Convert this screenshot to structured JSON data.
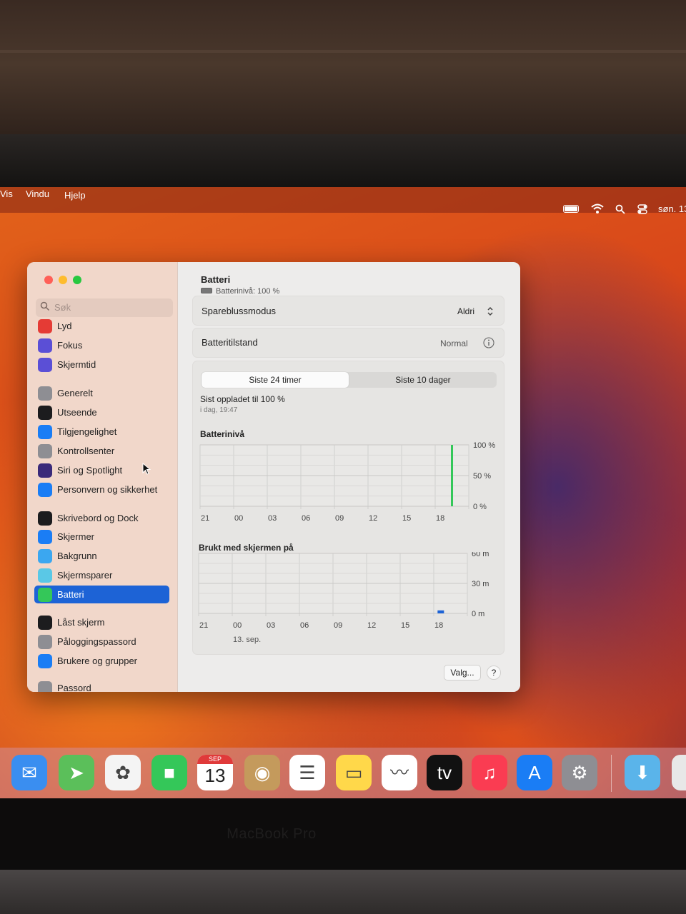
{
  "menubar": {
    "items": [
      "Vis",
      "Vindu",
      "Hjelp"
    ],
    "clock": "søn. 13"
  },
  "sidebar": {
    "search_placeholder": "Søk",
    "items": [
      {
        "label": "Lyd",
        "icon": "speaker-icon",
        "color": "#e53b35"
      },
      {
        "label": "Fokus",
        "icon": "moon-icon",
        "color": "#5b4fd6"
      },
      {
        "label": "Skjermtid",
        "icon": "hourglass-icon",
        "color": "#5b4fd6"
      },
      {
        "label": "Generelt",
        "icon": "gear-icon",
        "color": "#8e8e93"
      },
      {
        "label": "Utseende",
        "icon": "appearance-icon",
        "color": "#1c1c1e"
      },
      {
        "label": "Tilgjengelighet",
        "icon": "accessibility-icon",
        "color": "#1a7df5"
      },
      {
        "label": "Kontrollsenter",
        "icon": "toggles-icon",
        "color": "#8e8e93"
      },
      {
        "label": "Siri og Spotlight",
        "icon": "siri-icon",
        "color": "#3a2a7a"
      },
      {
        "label": "Personvern og sikkerhet",
        "icon": "hand-icon",
        "color": "#1a7df5"
      },
      {
        "label": "Skrivebord og Dock",
        "icon": "dock-icon",
        "color": "#1c1c1e"
      },
      {
        "label": "Skjermer",
        "icon": "sun-icon",
        "color": "#1a7df5"
      },
      {
        "label": "Bakgrunn",
        "icon": "flower-icon",
        "color": "#3ba7f0"
      },
      {
        "label": "Skjermsparer",
        "icon": "screensaver-icon",
        "color": "#5ac8e6"
      },
      {
        "label": "Batteri",
        "icon": "battery-icon",
        "color": "#34c759"
      },
      {
        "label": "Låst skjerm",
        "icon": "lock-icon",
        "color": "#1c1c1e"
      },
      {
        "label": "Påloggingspassord",
        "icon": "lock-icon",
        "color": "#8e8e93"
      },
      {
        "label": "Brukere og grupper",
        "icon": "users-icon",
        "color": "#1a7df5"
      },
      {
        "label": "Passord",
        "icon": "key-icon",
        "color": "#8e8e93"
      }
    ],
    "active": "Batteri"
  },
  "main": {
    "title": "Batteri",
    "subtitle": "Batterinivå: 100 %",
    "low_power_label": "Spareblussmodus",
    "low_power_value": "Aldri",
    "health_label": "Batteritilstand",
    "health_value": "Normal",
    "tabs": [
      "Siste 24 timer",
      "Siste 10 dager"
    ],
    "active_tab": "Siste 24 timer",
    "last_charged": "Sist oppladet til 100 %",
    "last_charged_time": "i dag, 19:47",
    "options_button": "Valg...",
    "help_button": "?"
  },
  "chart_data": [
    {
      "type": "bar",
      "title": "Batterinivå",
      "x_ticks": [
        "21",
        "00",
        "03",
        "06",
        "09",
        "12",
        "15",
        "18"
      ],
      "y_ticks": [
        "100 %",
        "50 %",
        "0 %"
      ],
      "ylim": [
        0,
        100
      ],
      "series": [
        {
          "values": [
            0,
            0,
            0,
            0,
            0,
            0,
            0,
            0,
            0,
            0,
            0,
            0,
            0,
            0,
            0,
            0,
            0,
            0,
            0,
            0,
            0,
            0,
            100,
            0
          ]
        }
      ],
      "bar_color": "#34c759",
      "grid": true
    },
    {
      "type": "bar",
      "title": "Brukt med skjermen på",
      "x_ticks": [
        "21",
        "00",
        "03",
        "06",
        "09",
        "12",
        "15",
        "18"
      ],
      "x_sub": "13. sep.",
      "y_ticks": [
        "60 m",
        "30 m",
        "0 m"
      ],
      "ylim": [
        0,
        60
      ],
      "series": [
        {
          "values": [
            0,
            0,
            0,
            0,
            0,
            0,
            0,
            0,
            0,
            0,
            0,
            0,
            0,
            0,
            0,
            0,
            0,
            0,
            0,
            0,
            0,
            3,
            0,
            0
          ]
        }
      ],
      "bar_color": "#1d63d6",
      "grid": true
    }
  ],
  "dock": {
    "apps": [
      {
        "name": "mail-icon",
        "color": "#3a8ef0",
        "glyph": "✉"
      },
      {
        "name": "maps-icon",
        "color": "#5bbf5a",
        "glyph": "➤"
      },
      {
        "name": "photos-icon",
        "color": "#f4f4f4",
        "glyph": "✿"
      },
      {
        "name": "facetime-icon",
        "color": "#34c759",
        "glyph": "■"
      },
      {
        "name": "calendar-icon",
        "color": "#ffffff",
        "glyph": "13",
        "month": "SEP"
      },
      {
        "name": "contacts-icon",
        "color": "#c49a5c",
        "glyph": "◉"
      },
      {
        "name": "reminders-icon",
        "color": "#ffffff",
        "glyph": "☰"
      },
      {
        "name": "notes-icon",
        "color": "#ffd84a",
        "glyph": "▭"
      },
      {
        "name": "freeform-icon",
        "color": "#ffffff",
        "glyph": "〰"
      },
      {
        "name": "appletv-icon",
        "color": "#111111",
        "glyph": "tv"
      },
      {
        "name": "music-icon",
        "color": "#fa3c52",
        "glyph": "♫"
      },
      {
        "name": "appstore-icon",
        "color": "#1a7df5",
        "glyph": "A"
      },
      {
        "name": "system-settings-icon",
        "color": "#8e8e93",
        "glyph": "⚙"
      },
      {
        "name": "downloads-folder-icon",
        "color": "#5ab4ea",
        "glyph": "⬇"
      },
      {
        "name": "trash-icon",
        "color": "#e8e8e8",
        "glyph": ""
      }
    ]
  },
  "hardware": {
    "model_label": "MacBook Pro"
  }
}
